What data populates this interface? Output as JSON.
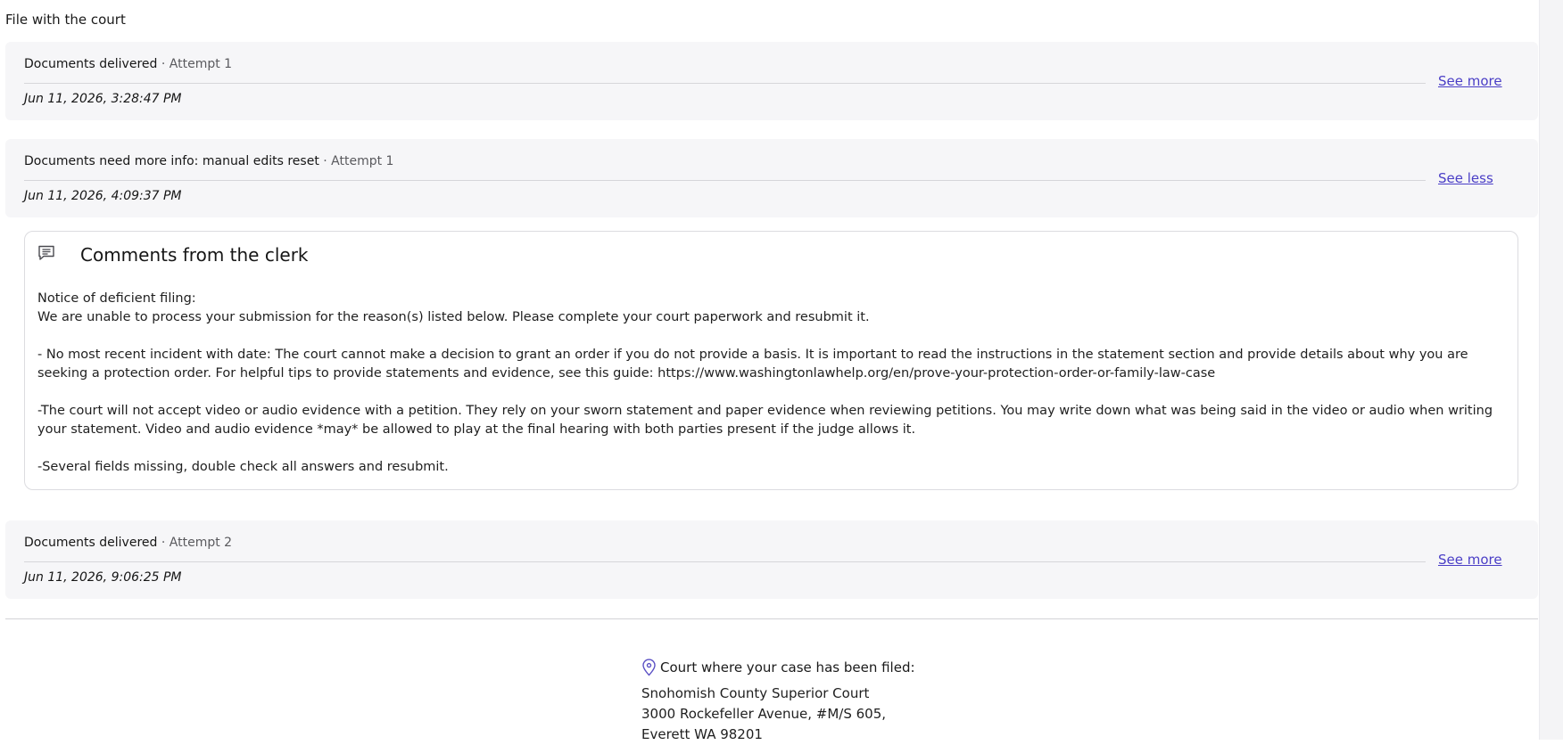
{
  "section": {
    "title": "File with the court"
  },
  "events": [
    {
      "title": "Documents delivered",
      "attempt": "Attempt 1",
      "time": "Jun 11, 2026, 3:28:47 PM",
      "link": "See more"
    },
    {
      "title": "Documents need more info: manual edits reset",
      "attempt": "Attempt 1",
      "time": "Jun 11, 2026, 4:09:37 PM",
      "link": "See less"
    },
    {
      "title": "Documents delivered",
      "attempt": "Attempt 2",
      "time": "Jun 11, 2026, 9:06:25 PM",
      "link": "See more"
    }
  ],
  "separator": "·",
  "comments": {
    "title": "Comments from the clerk",
    "icon": "comment-icon",
    "lines": [
      "Notice of deficient filing:",
      "We are unable to process your submission for the reason(s) listed below. Please complete your court paperwork and resubmit it.",
      "- No most recent incident with date: The court cannot make a decision to grant an order if you do not provide a basis. It is important to read the instructions in the statement section and provide details about why you are seeking a protection order. For helpful tips to provide statements and evidence, see this guide: https://www.washingtonlawhelp.org/en/prove-your-protection-order-or-family-law-case",
      "-The court will not accept video or audio evidence with a petition. They rely on your sworn statement and paper evidence when reviewing petitions. You may write down what was being said in the video or audio when writing your statement. Video and audio evidence *may* be allowed to play at the final hearing with both parties present if the judge allows it.",
      "-Several fields missing, double check all answers and resubmit."
    ]
  },
  "court": {
    "icon": "location-pin-icon",
    "label": "Court where your case has been filed:",
    "name": "Snohomish County Superior Court",
    "address1": "3000 Rockefeller Avenue, #M/S 605,",
    "address2": "Everett WA 98201"
  },
  "colors": {
    "accent": "#4a3ec6",
    "card_bg": "#f6f6f8",
    "border": "#dcdce0"
  }
}
